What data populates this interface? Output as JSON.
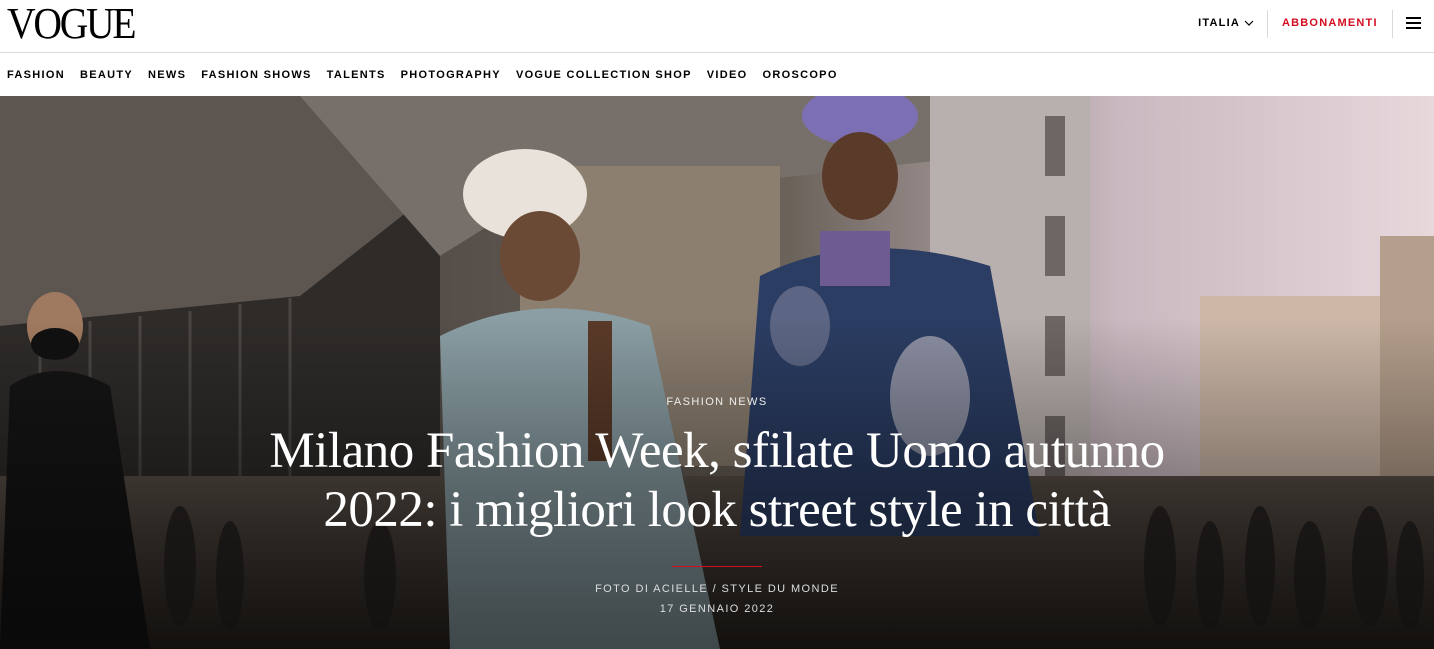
{
  "header": {
    "logo": "VOGUE",
    "edition": "ITALIA",
    "subscribe": "ABBONAMENTI"
  },
  "nav": {
    "items": [
      "FASHION",
      "BEAUTY",
      "NEWS",
      "FASHION SHOWS",
      "TALENTS",
      "PHOTOGRAPHY",
      "VOGUE COLLECTION SHOP",
      "VIDEO",
      "OROSCOPO"
    ]
  },
  "hero": {
    "kicker": "FASHION NEWS",
    "headline": "Milano Fashion Week, sfilate Uomo autunno 2022: i migliori look street style in città",
    "credit": "FOTO DI ACIELLE / STYLE DU MONDE",
    "date": "17 GENNAIO 2022"
  },
  "colors": {
    "accent": "#d30d1f",
    "border": "#d9d9d9",
    "text": "#000000"
  },
  "icons": [
    "chevron-down-icon",
    "hamburger-menu-icon"
  ]
}
